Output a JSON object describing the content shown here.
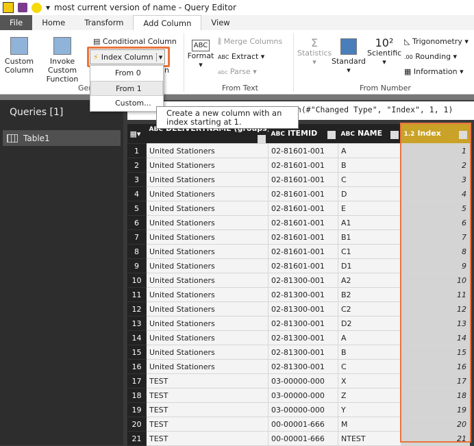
{
  "window": {
    "title": "most current version of name - Query Editor"
  },
  "tabs": [
    "File",
    "Home",
    "Transform",
    "Add Column",
    "View"
  ],
  "ribbon": {
    "custom_column": [
      "Custom",
      "Column"
    ],
    "invoke_custom_function": [
      "Invoke Custom",
      "Function"
    ],
    "conditional_column": "Conditional Column",
    "index_column": "Index Column",
    "general_group": "Ger",
    "general_group_tail": "n",
    "format": "Format",
    "merge_columns": "Merge Columns",
    "extract": "Extract",
    "parse": "Parse",
    "from_text_group": "From Text",
    "statistics": "Statistics",
    "standard": "Standard",
    "scientific": "Scientific",
    "scientific_glyph": "10²",
    "trigonometry": "Trigonometry",
    "rounding": "Rounding",
    "information": "Information",
    "from_number_group": "From Number"
  },
  "index_menu": [
    "From 0",
    "From 1",
    "Custom..."
  ],
  "tooltip": "Create a new column with an index starting at 1.",
  "queries": {
    "header": "Queries [1]",
    "items": [
      "Table1"
    ]
  },
  "formula": "mn(#\"Changed Type\", \"Index\", 1, 1)",
  "table": {
    "columns": [
      {
        "type": "ABC",
        "name": "DELIVERYNAME (groups)"
      },
      {
        "type": "ABC",
        "name": "ITEMID"
      },
      {
        "type": "ABC",
        "name": "NAME"
      },
      {
        "type": "1.2",
        "name": "Index"
      }
    ],
    "rows": [
      [
        "United Stationers",
        "02-81601-001",
        "A",
        "1"
      ],
      [
        "United Stationers",
        "02-81601-001",
        "B",
        "2"
      ],
      [
        "United Stationers",
        "02-81601-001",
        "C",
        "3"
      ],
      [
        "United Stationers",
        "02-81601-001",
        "D",
        "4"
      ],
      [
        "United Stationers",
        "02-81601-001",
        "E",
        "5"
      ],
      [
        "United Stationers",
        "02-81601-001",
        "A1",
        "6"
      ],
      [
        "United Stationers",
        "02-81601-001",
        "B1",
        "7"
      ],
      [
        "United Stationers",
        "02-81601-001",
        "C1",
        "8"
      ],
      [
        "United Stationers",
        "02-81601-001",
        "D1",
        "9"
      ],
      [
        "United Stationers",
        "02-81300-001",
        "A2",
        "10"
      ],
      [
        "United Stationers",
        "02-81300-001",
        "B2",
        "11"
      ],
      [
        "United Stationers",
        "02-81300-001",
        "C2",
        "12"
      ],
      [
        "United Stationers",
        "02-81300-001",
        "D2",
        "13"
      ],
      [
        "United Stationers",
        "02-81300-001",
        "A",
        "14"
      ],
      [
        "United Stationers",
        "02-81300-001",
        "B",
        "15"
      ],
      [
        "United Stationers",
        "02-81300-001",
        "C",
        "16"
      ],
      [
        "TEST",
        "03-00000-000",
        "X",
        "17"
      ],
      [
        "TEST",
        "03-00000-000",
        "Z",
        "18"
      ],
      [
        "TEST",
        "03-00000-000",
        "Y",
        "19"
      ],
      [
        "TEST",
        "00-00001-666",
        "M",
        "20"
      ],
      [
        "TEST",
        "00-00001-666",
        "NTEST",
        "21"
      ]
    ]
  },
  "colors": {
    "highlight": "#e8743b",
    "index_header": "#c9a227"
  }
}
